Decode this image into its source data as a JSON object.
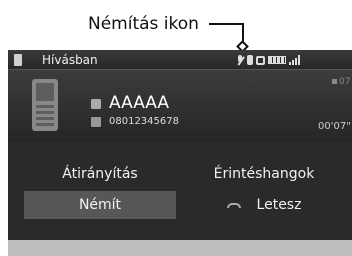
{
  "callout": {
    "label": "Némítás ikon"
  },
  "status_bar": {
    "title": "Hívásban"
  },
  "caller": {
    "name": "AAAAA",
    "number": "08012345678",
    "volume_text": "07",
    "call_time": "00'07\""
  },
  "buttons": {
    "transfer": "Átirányítás",
    "touch_tones": "Érintéshangok",
    "mute": "Némít",
    "hang_up": "Letesz"
  }
}
